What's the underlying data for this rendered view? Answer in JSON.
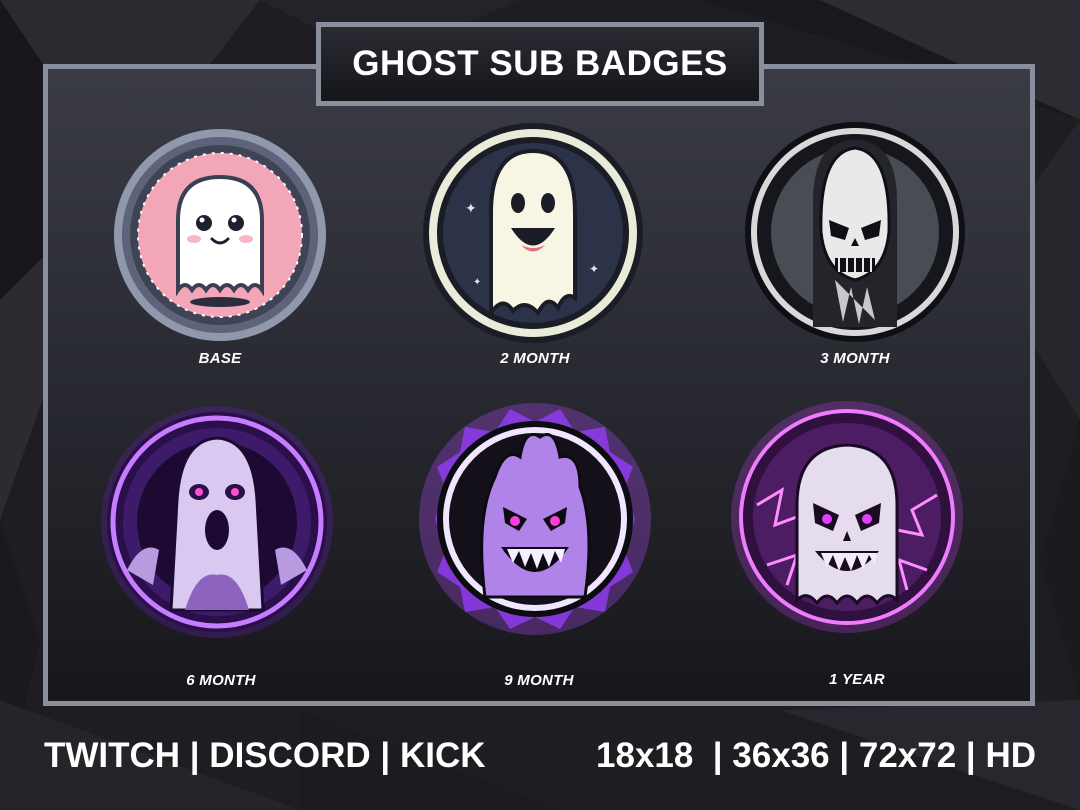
{
  "title": "GHOST SUB BADGES",
  "badges": [
    {
      "label": "BASE",
      "icon": "cute-ghost-icon",
      "theme": "pink"
    },
    {
      "label": "2 MONTH",
      "icon": "smiling-ghost-icon",
      "theme": "navy"
    },
    {
      "label": "3 MONTH",
      "icon": "skull-icon",
      "theme": "grey"
    },
    {
      "label": "6 MONTH",
      "icon": "screaming-ghost-icon",
      "theme": "purple"
    },
    {
      "label": "9 MONTH",
      "icon": "flaming-demon-icon",
      "theme": "purple-fire"
    },
    {
      "label": "1 YEAR",
      "icon": "lightning-skull-ghost-icon",
      "theme": "purple-lightning"
    }
  ],
  "footer": {
    "platforms": "TWITCH | DISCORD | KICK",
    "sizes": "18x18  | 36x36 | 72x72 | HD"
  },
  "colors": {
    "background": "#1b1b1f",
    "frame": "#8a8f9e",
    "pink": "#f2a6b8",
    "navy": "#2c3248",
    "purple": "#a64dff",
    "glow": "#c77dff"
  }
}
